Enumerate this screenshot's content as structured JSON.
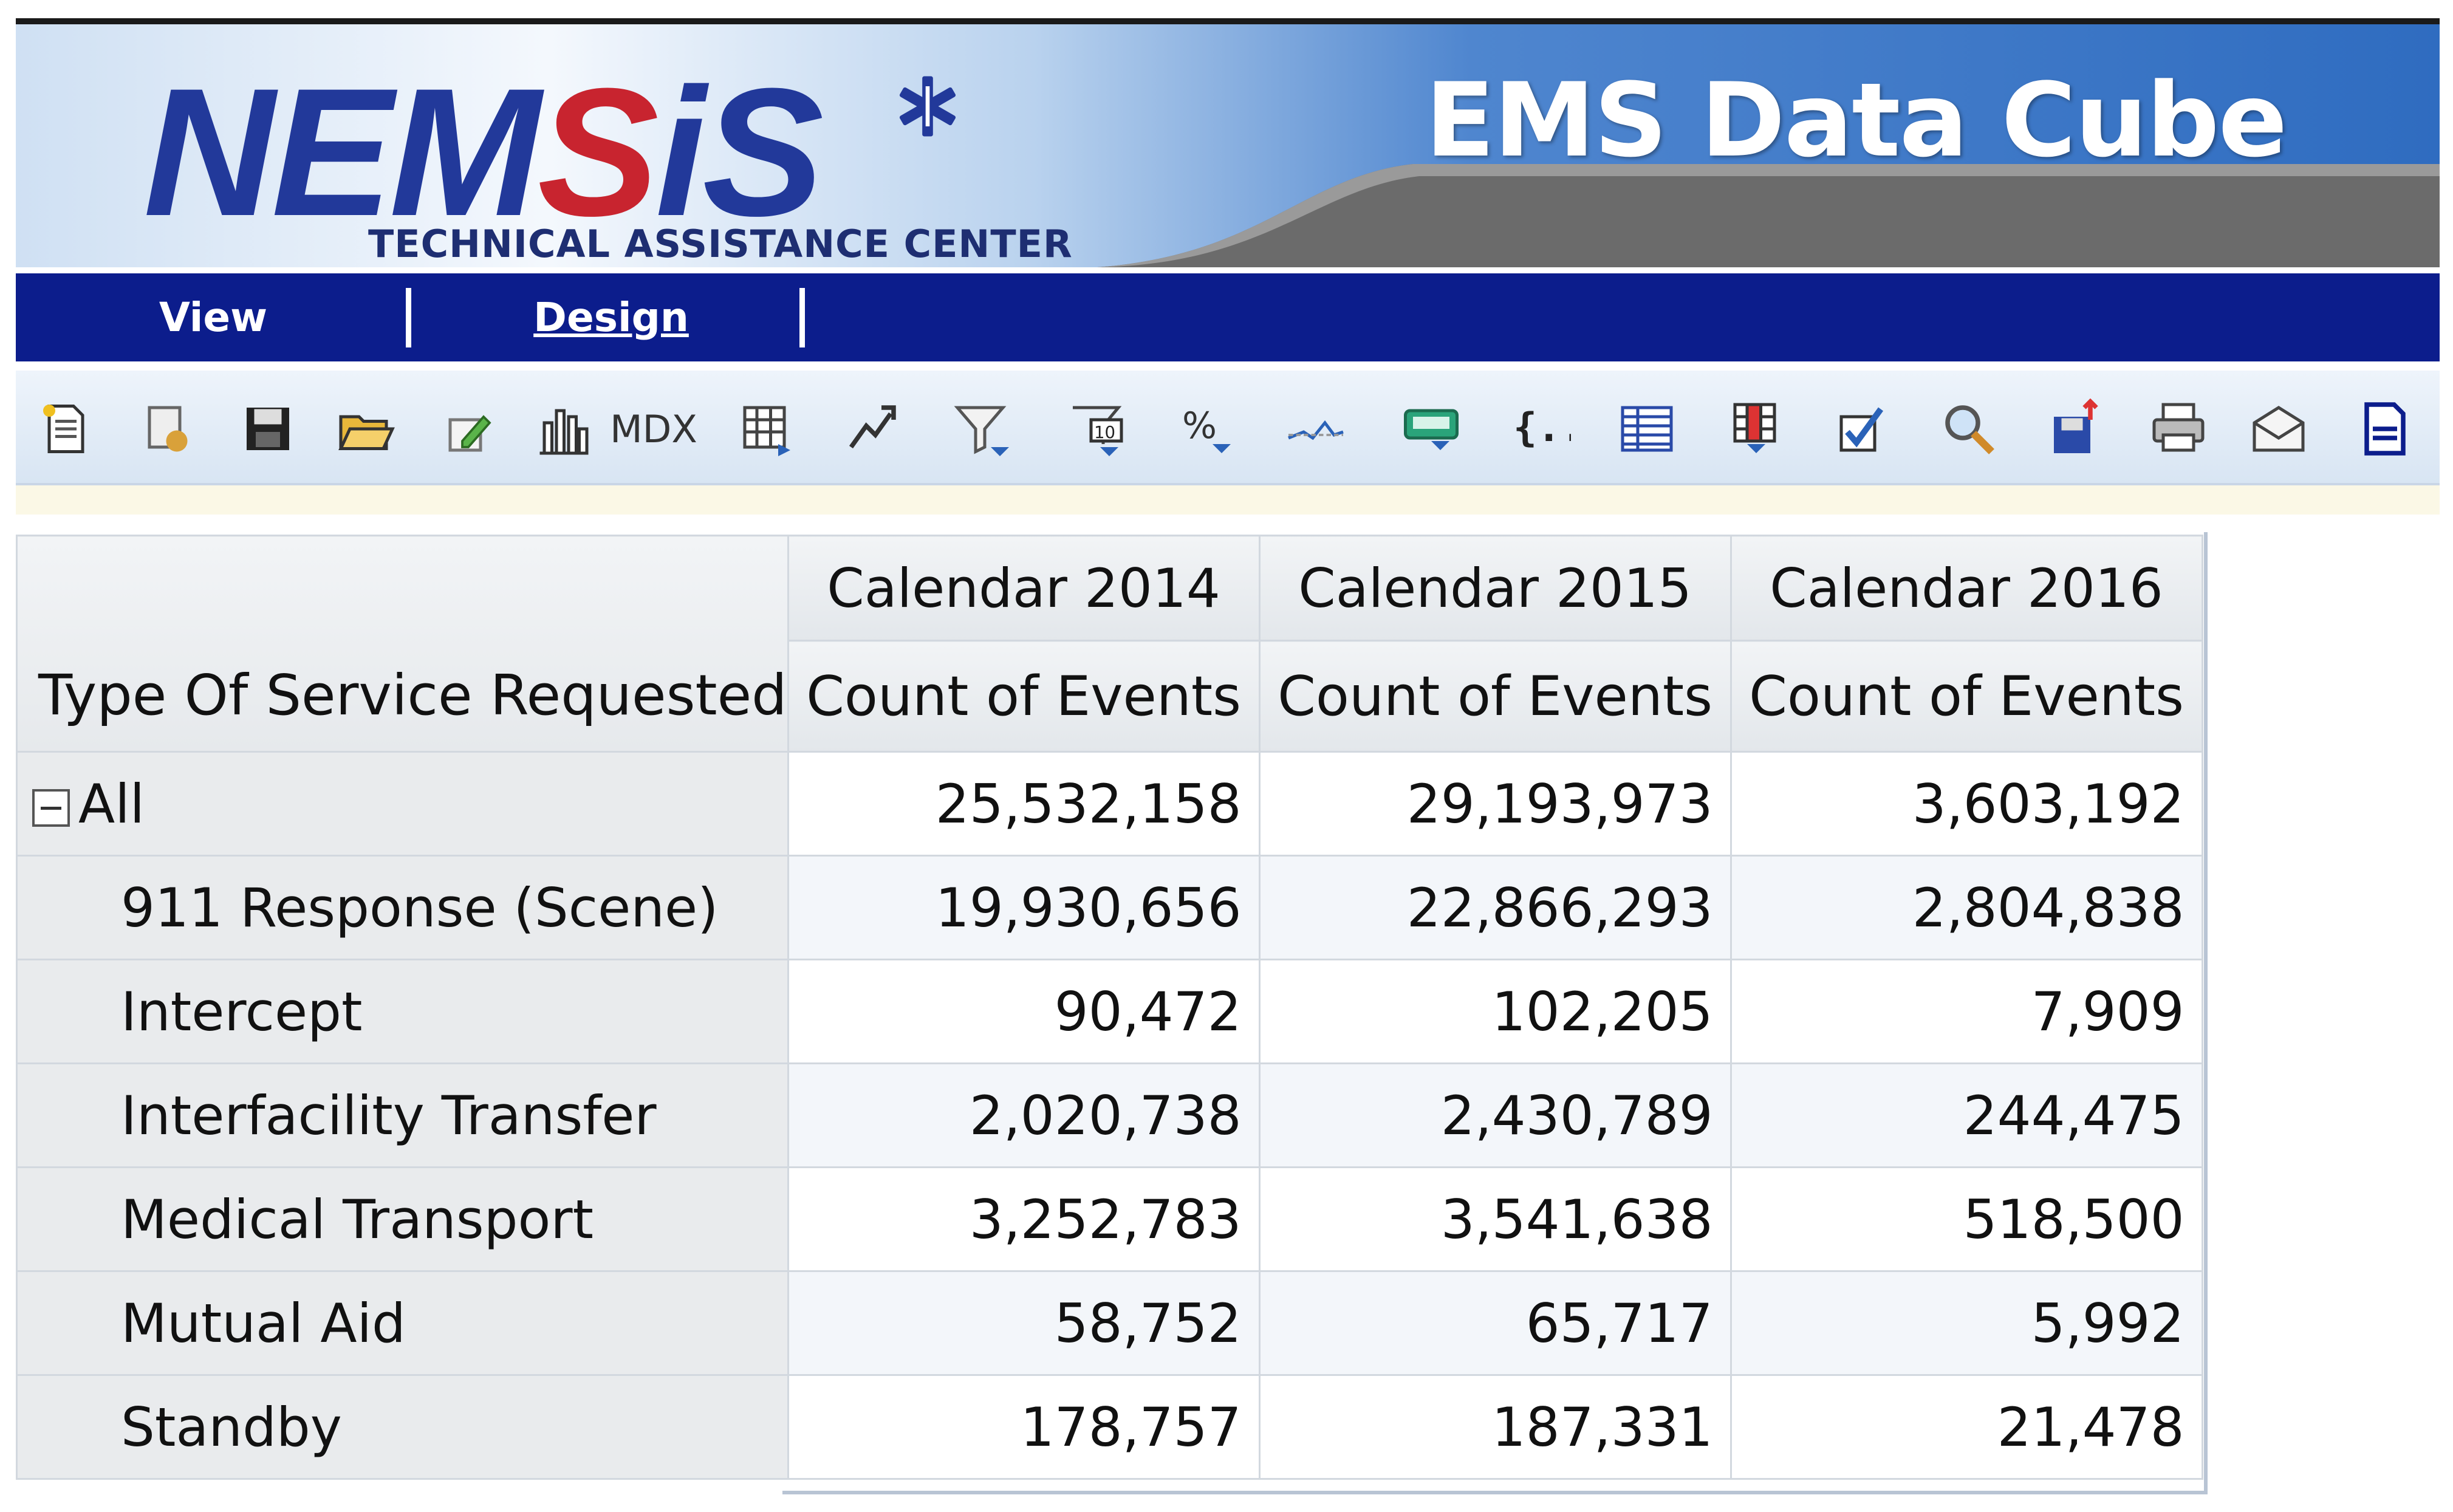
{
  "header": {
    "logo_parts": [
      "NEM",
      "S",
      "i",
      "S"
    ],
    "logo_subtitle": "TECHNICAL ASSISTANCE CENTER",
    "app_title": "EMS Data Cube"
  },
  "nav": {
    "tabs": [
      {
        "label": "View",
        "active": true
      },
      {
        "label": "Design",
        "active": false
      }
    ]
  },
  "toolbar": {
    "mdx_label": "MDX",
    "icons": [
      "new-report-icon",
      "properties-icon",
      "save-icon",
      "open-folder-icon",
      "edit-icon",
      "chart-icon",
      "mdx-button",
      "pivot-grid-icon",
      "drill-icon",
      "filter-icon",
      "top-ten-icon",
      "percent-icon",
      "trend-line-icon",
      "calculator-icon",
      "braces-icon",
      "table-layout-icon",
      "column-select-icon",
      "checkbox-icon",
      "search-icon",
      "export-icon",
      "print-icon",
      "email-icon",
      "document-icon"
    ]
  },
  "table": {
    "row_dimension": "Type Of Service Requested",
    "columns": [
      {
        "year": "Calendar 2014",
        "measure": "Count of Events"
      },
      {
        "year": "Calendar 2015",
        "measure": "Count of Events"
      },
      {
        "year": "Calendar 2016",
        "measure": "Count of Events"
      }
    ],
    "rows": [
      {
        "label": "All",
        "values": [
          "25,532,158",
          "29,193,973",
          "3,603,192"
        ]
      },
      {
        "label": "911 Response (Scene)",
        "values": [
          "19,930,656",
          "22,866,293",
          "2,804,838"
        ]
      },
      {
        "label": "Intercept",
        "values": [
          "90,472",
          "102,205",
          "7,909"
        ]
      },
      {
        "label": "Interfacility Transfer",
        "values": [
          "2,020,738",
          "2,430,789",
          "244,475"
        ]
      },
      {
        "label": "Medical Transport",
        "values": [
          "3,252,783",
          "3,541,638",
          "518,500"
        ]
      },
      {
        "label": "Mutual Aid",
        "values": [
          "58,752",
          "65,717",
          "5,992"
        ]
      },
      {
        "label": "Standby",
        "values": [
          "178,757",
          "187,331",
          "21,478"
        ]
      }
    ]
  },
  "colors": {
    "nav_background": "#0c1d8c",
    "logo_blue": "#22399a",
    "logo_red": "#c8242f",
    "banner_blue": "#2f6cc0"
  }
}
